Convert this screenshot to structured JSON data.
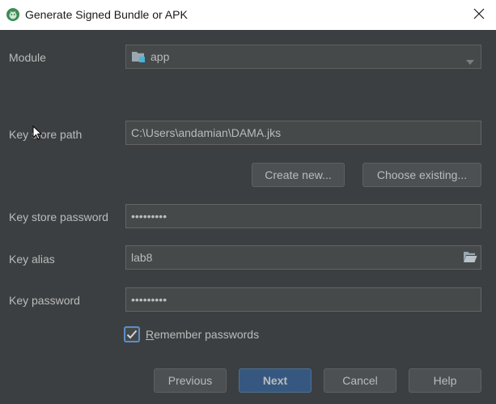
{
  "window": {
    "title": "Generate Signed Bundle or APK",
    "app_icon": "android-studio-icon",
    "close_icon": "close-icon"
  },
  "form": {
    "module": {
      "label": "Module",
      "value": "app",
      "icon": "module-folder-icon"
    },
    "key_store_path": {
      "label": "Key store path",
      "value": "C:\\Users\\andamian\\DAMA.jks"
    },
    "create_new_label": "Create new...",
    "choose_existing_label": "Choose existing...",
    "key_store_password": {
      "label": "Key store password",
      "value": "•••••••••"
    },
    "key_alias": {
      "label": "Key alias",
      "value": "lab8",
      "icon": "folder-open-icon"
    },
    "key_password": {
      "label": "Key password",
      "value": "•••••••••"
    },
    "remember_passwords": {
      "mnemonic": "R",
      "rest": "emember passwords",
      "checked": true
    }
  },
  "footer": {
    "previous_label": "Previous",
    "next_label": "Next",
    "cancel_label": "Cancel",
    "help_label": "Help"
  },
  "colors": {
    "background": "#3c3f41",
    "field_bg": "#45494a",
    "primary_button": "#365880",
    "text": "#bbbbbb"
  }
}
